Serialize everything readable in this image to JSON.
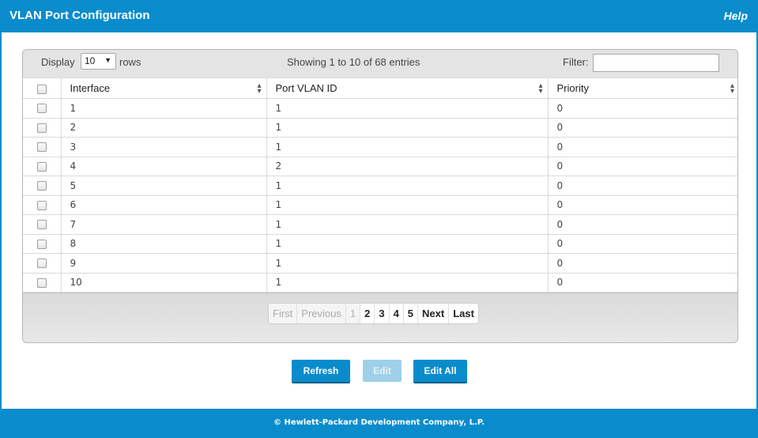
{
  "header": {
    "title": "VLAN Port Configuration",
    "help": "Help"
  },
  "toolbar": {
    "display_label": "Display",
    "rows_value": "10",
    "rows_label": "rows",
    "showing": "Showing 1 to 10 of 68 entries",
    "filter_label": "Filter:",
    "filter_value": ""
  },
  "table": {
    "columns": [
      "Interface",
      "Port VLAN ID",
      "Priority"
    ],
    "rows": [
      {
        "interface": "1",
        "pvid": "1",
        "priority": "0"
      },
      {
        "interface": "2",
        "pvid": "1",
        "priority": "0"
      },
      {
        "interface": "3",
        "pvid": "1",
        "priority": "0"
      },
      {
        "interface": "4",
        "pvid": "2",
        "priority": "0"
      },
      {
        "interface": "5",
        "pvid": "1",
        "priority": "0"
      },
      {
        "interface": "6",
        "pvid": "1",
        "priority": "0"
      },
      {
        "interface": "7",
        "pvid": "1",
        "priority": "0"
      },
      {
        "interface": "8",
        "pvid": "1",
        "priority": "0"
      },
      {
        "interface": "9",
        "pvid": "1",
        "priority": "0"
      },
      {
        "interface": "10",
        "pvid": "1",
        "priority": "0"
      }
    ]
  },
  "pager": {
    "first": "First",
    "previous": "Previous",
    "pages": [
      "1",
      "2",
      "3",
      "4",
      "5"
    ],
    "current_page": "1",
    "next": "Next",
    "last": "Last"
  },
  "buttons": {
    "refresh": "Refresh",
    "edit": "Edit",
    "edit_all": "Edit All"
  },
  "footer": {
    "copyright": "© Hewlett-Packard Development Company, L.P."
  },
  "colors": {
    "brand": "#0a8ccc",
    "disabled_button": "#9fd0ea"
  }
}
